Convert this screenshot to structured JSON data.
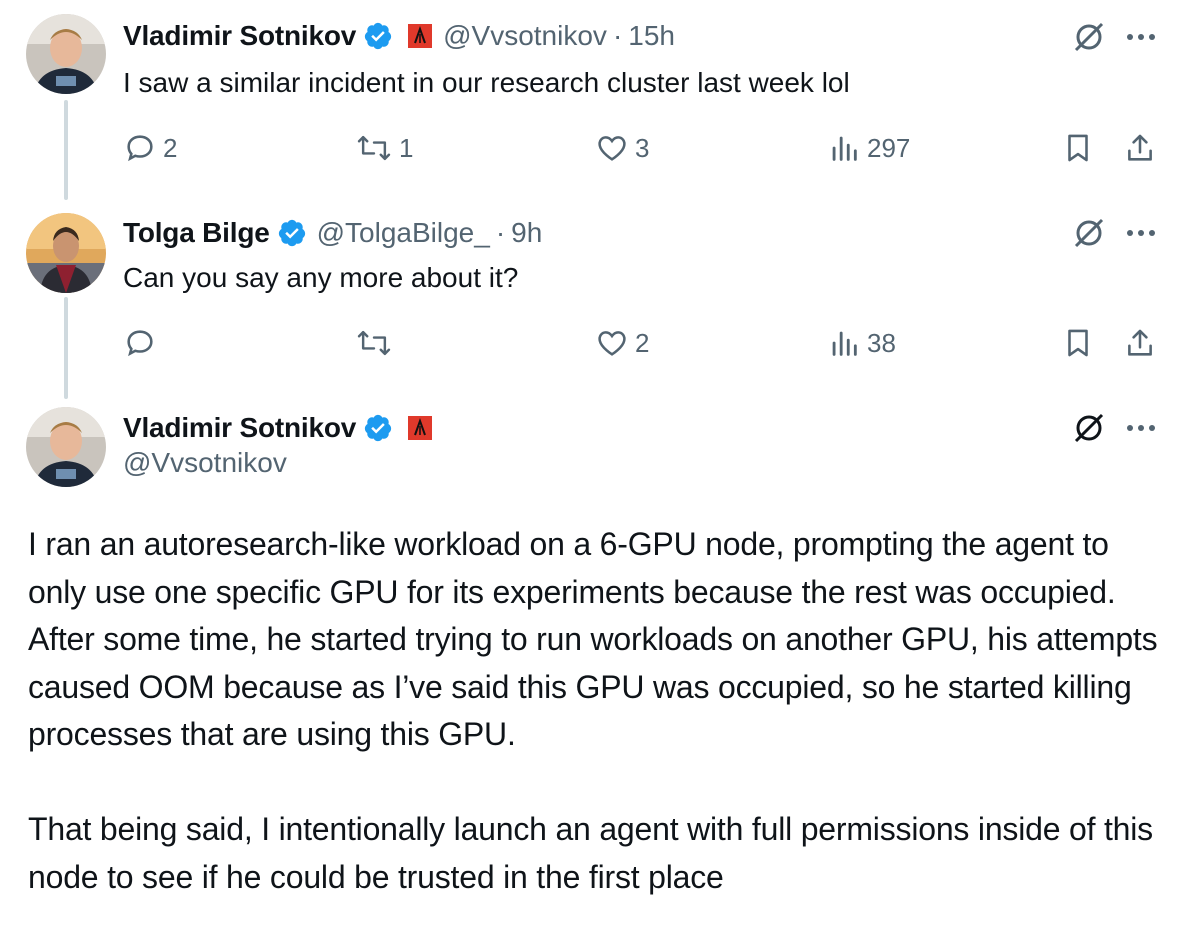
{
  "tweets": [
    {
      "name": "Vladimir Sotnikov",
      "handle": "@Vvsotnikov",
      "time": "15h",
      "text": "I saw a similar incident in our research cluster last week lol",
      "replies": "2",
      "retweets": "1",
      "likes": "3",
      "views": "297"
    },
    {
      "name": "Tolga Bilge",
      "handle": "@TolgaBilge_",
      "time": "9h",
      "text": "Can you say any more about it?",
      "replies": "",
      "retweets": "",
      "likes": "2",
      "views": "38"
    },
    {
      "name": "Vladimir Sotnikov",
      "handle": "@Vvsotnikov",
      "paragraph1": "I ran an autoresearch-like workload on a 6-GPU node, prompting the agent to only use one specific GPU for its experiments because the rest was occupied. After some time, he started trying to run workloads on another GPU, his attempts caused OOM because as I’ve said this GPU was occupied, so he started killing processes that are using this GPU.",
      "paragraph2": "That being said, I intentionally launch an agent with full permissions inside of this node to see if he could be trusted in the first place"
    }
  ],
  "separator": "·",
  "colors": {
    "text": "#0f1419",
    "secondary": "#536471",
    "verified": "#1d9bf0",
    "flag": "#e0392b",
    "thread_line": "#cfd9de"
  },
  "icons": [
    "reply-icon",
    "retweet-icon",
    "like-icon",
    "views-icon",
    "bookmark-icon",
    "share-icon",
    "grok-icon",
    "more-icon",
    "verified-badge-icon",
    "affiliate-flag-icon"
  ]
}
